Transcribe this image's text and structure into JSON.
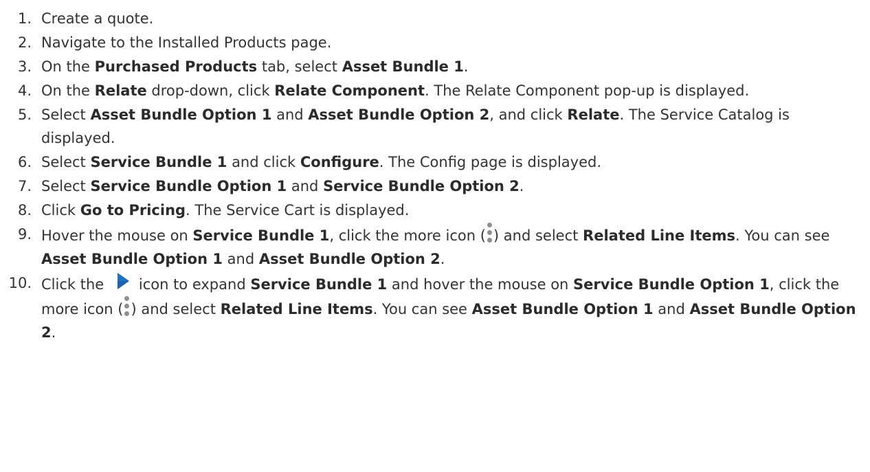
{
  "steps": [
    {
      "num": "1.",
      "parts": [
        {
          "t": "Create a quote."
        }
      ]
    },
    {
      "num": "2.",
      "parts": [
        {
          "t": "Navigate to the Installed Products page."
        }
      ]
    },
    {
      "num": "3.",
      "parts": [
        {
          "t": "On the "
        },
        {
          "t": "Purchased Products",
          "b": true
        },
        {
          "t": " tab, select "
        },
        {
          "t": "Asset Bundle 1",
          "b": true
        },
        {
          "t": "."
        }
      ]
    },
    {
      "num": "4.",
      "parts": [
        {
          "t": "On the "
        },
        {
          "t": "Relate",
          "b": true
        },
        {
          "t": " drop-down, click "
        },
        {
          "t": "Relate Component",
          "b": true
        },
        {
          "t": ". The Relate Component pop-up is displayed."
        }
      ]
    },
    {
      "num": "5.",
      "parts": [
        {
          "t": "Select "
        },
        {
          "t": "Asset Bundle Option 1",
          "b": true
        },
        {
          "t": " and "
        },
        {
          "t": "Asset Bundle Option 2",
          "b": true
        },
        {
          "t": ", and click "
        },
        {
          "t": "Relate",
          "b": true
        },
        {
          "t": ". The Service Catalog is displayed."
        }
      ]
    },
    {
      "num": "6.",
      "parts": [
        {
          "t": "Select "
        },
        {
          "t": "Service Bundle 1",
          "b": true
        },
        {
          "t": " and click "
        },
        {
          "t": "Configure",
          "b": true
        },
        {
          "t": ". The Config page is displayed."
        }
      ]
    },
    {
      "num": "7.",
      "parts": [
        {
          "t": "Select "
        },
        {
          "t": "Service Bundle Option 1",
          "b": true
        },
        {
          "t": " and "
        },
        {
          "t": "Service Bundle Option 2",
          "b": true
        },
        {
          "t": "."
        }
      ]
    },
    {
      "num": "8.",
      "parts": [
        {
          "t": "Click "
        },
        {
          "t": "Go to Pricing",
          "b": true
        },
        {
          "t": ". The Service Cart is displayed."
        }
      ]
    },
    {
      "num": "9.",
      "parts": [
        {
          "t": "Hover the mouse on "
        },
        {
          "t": "Service Bundle 1",
          "b": true
        },
        {
          "t": ", click the more icon ("
        },
        {
          "icon": "more-vertical-icon"
        },
        {
          "t": ") and select "
        },
        {
          "t": "Related Line Items",
          "b": true
        },
        {
          "t": ". You can see "
        },
        {
          "t": "Asset Bundle Option 1",
          "b": true
        },
        {
          "t": " and "
        },
        {
          "t": "Asset Bundle Option 2",
          "b": true
        },
        {
          "t": "."
        }
      ]
    },
    {
      "num": "10.",
      "parts": [
        {
          "t": "Click the "
        },
        {
          "icon": "expand-arrow-icon"
        },
        {
          "t": "icon to expand "
        },
        {
          "t": "Service Bundle 1",
          "b": true
        },
        {
          "t": " and hover the mouse on "
        },
        {
          "t": "Service Bundle Option 1",
          "b": true
        },
        {
          "t": ", click the more icon ("
        },
        {
          "icon": "more-vertical-icon"
        },
        {
          "t": ") and select "
        },
        {
          "t": "Related Line Items",
          "b": true
        },
        {
          "t": ". You can see "
        },
        {
          "t": "Asset Bundle Option 1",
          "b": true
        },
        {
          "t": " and "
        },
        {
          "t": "Asset Bundle Option 2",
          "b": true
        },
        {
          "t": "."
        }
      ]
    }
  ],
  "colors": {
    "text": "#333333",
    "icon_blue": "#1a73c8",
    "icon_gray": "#8e8e8e"
  }
}
